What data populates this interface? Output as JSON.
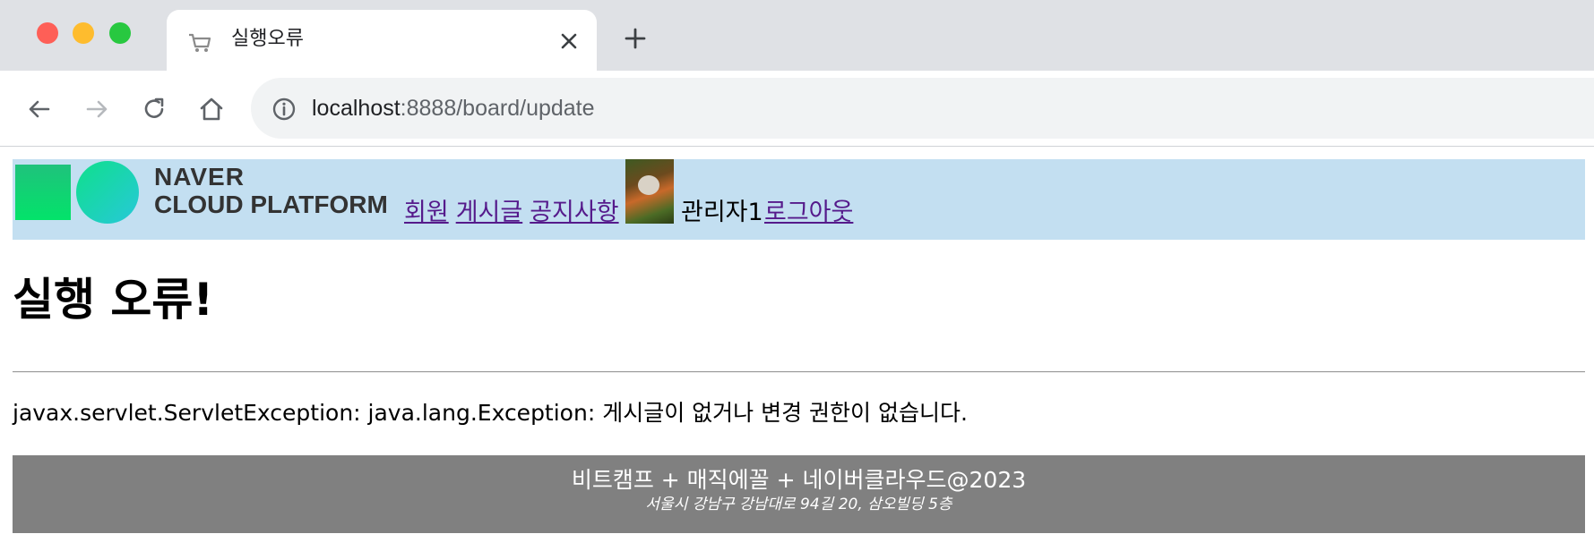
{
  "browser": {
    "tab": {
      "title": "실행오류",
      "favicon": "cart-icon"
    },
    "address": {
      "host": "localhost",
      "rest": ":8888/board/update"
    }
  },
  "header": {
    "logo": {
      "line1": "NAVER",
      "line2": "CLOUD PLATFORM"
    },
    "menu": [
      {
        "label": "회원"
      },
      {
        "label": "게시글"
      },
      {
        "label": "공지사항"
      }
    ],
    "user": {
      "name": "관리자1",
      "avatar": "red-panda-photo"
    },
    "logout_label": "로그아웃"
  },
  "main": {
    "title": "실행 오류!",
    "message": "javax.servlet.ServletException: java.lang.Exception: 게시글이 없거나 변경 권한이 없습니다."
  },
  "footer": {
    "text": "비트캠프 + 매직에꼴 + 네이버클라우드@2023",
    "address": "서울시 강남구 강남대로 94길 20, 삼오빌딩 5층"
  },
  "colors": {
    "header_bg": "#c3dff1",
    "footer_bg": "#808080",
    "link": "#551a8b"
  }
}
